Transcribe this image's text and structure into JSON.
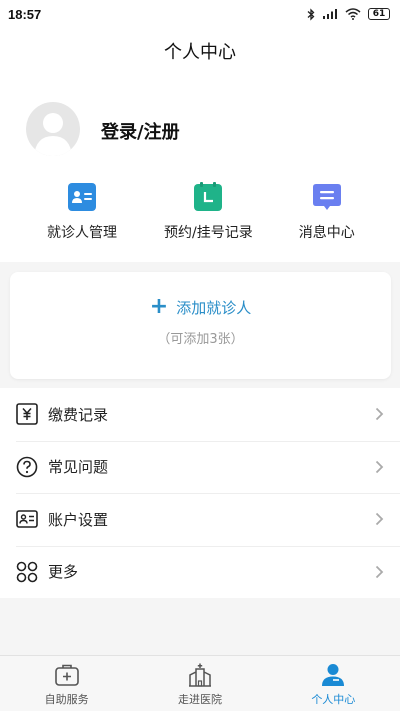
{
  "status_bar": {
    "time": "18:57",
    "battery": "61"
  },
  "header": {
    "title": "个人中心"
  },
  "profile": {
    "login_text": "登录/注册"
  },
  "quick_links": [
    {
      "label": "就诊人管理",
      "icon": "patient-card-icon",
      "color": "#2d8ce0"
    },
    {
      "label": "预约/挂号记录",
      "icon": "calendar-clock-icon",
      "color": "#1fb389"
    },
    {
      "label": "消息中心",
      "icon": "message-icon",
      "color": "#6a7ff0"
    }
  ],
  "add_patient": {
    "label": "添加就诊人",
    "hint": "（可添加3张）"
  },
  "menu": [
    {
      "label": "缴费记录",
      "icon": "yuan-icon"
    },
    {
      "label": "常见问题",
      "icon": "question-icon"
    },
    {
      "label": "账户设置",
      "icon": "id-card-icon"
    },
    {
      "label": "更多",
      "icon": "more-grid-icon"
    }
  ],
  "tabbar": [
    {
      "label": "自助服务",
      "icon": "medical-kit-icon",
      "active": false
    },
    {
      "label": "走进医院",
      "icon": "hospital-icon",
      "active": false
    },
    {
      "label": "个人中心",
      "icon": "person-icon",
      "active": true
    }
  ],
  "colors": {
    "accent": "#1a8ad4",
    "add_link": "#2a8ec8",
    "background": "#f5f5f5"
  }
}
